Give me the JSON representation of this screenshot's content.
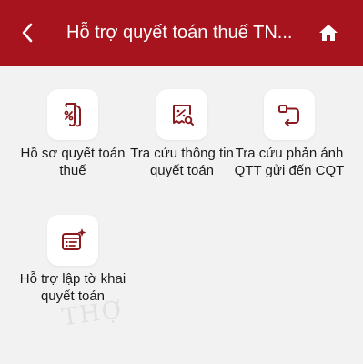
{
  "header": {
    "title": "Hỗ trợ quyết toán thuế TN...",
    "back_icon": "chevron-left-icon",
    "home_icon": "home-icon",
    "background_color": "#a8141d"
  },
  "tiles": [
    {
      "label": "Hồ sơ quyết toán thuế",
      "icon": "tax-document-icon"
    },
    {
      "label": "Tra cứu thông tin quyết toán",
      "icon": "lookup-receipt-icon"
    },
    {
      "label": "Tra cứu phản ánh QTT gửi đến CQT",
      "icon": "feedback-route-icon"
    },
    {
      "label": "Hỗ trợ lập tờ khai quyết toán",
      "icon": "form-sparkle-icon"
    }
  ],
  "watermark": "THỢ",
  "accent_color": "#8b1a1f"
}
